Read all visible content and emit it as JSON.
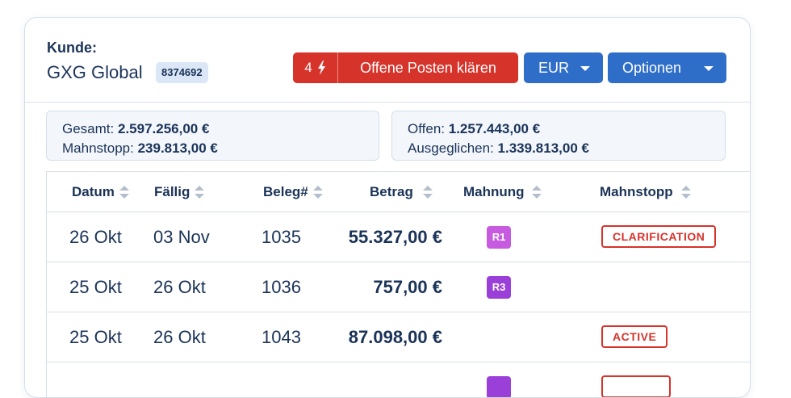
{
  "customer": {
    "label": "Kunde:",
    "name": "GXG Global",
    "id": "8374692"
  },
  "actions": {
    "open_count": "4",
    "open_label": "Offene Posten klären",
    "currency": "EUR",
    "options": "Optionen"
  },
  "summary": {
    "gesamt_label": "Gesamt:",
    "gesamt_value": "2.597.256,00 €",
    "mahnstopp_label": "Mahnstopp:",
    "mahnstopp_value": "239.813,00 €",
    "offen_label": "Offen:",
    "offen_value": "1.257.443,00 €",
    "ausgeglichen_label": "Ausgeglichen:",
    "ausgeglichen_value": "1.339.813,00 €"
  },
  "table": {
    "columns": [
      "Datum",
      "Fällig",
      "Beleg#",
      "Betrag",
      "Mahnung",
      "Mahnstopp"
    ],
    "rows": [
      {
        "datum": "26 Okt",
        "faellig": "03 Nov",
        "beleg": "1035",
        "betrag": "55.327,00 €",
        "mahnung": "R1",
        "mahnung_color": "#c65be0",
        "mahnstopp": "CLARIFICATION"
      },
      {
        "datum": "25 Okt",
        "faellig": "26 Okt",
        "beleg": "1036",
        "betrag": "757,00 €",
        "mahnung": "R3",
        "mahnung_color": "#9b3fd9",
        "mahnstopp": ""
      },
      {
        "datum": "25 Okt",
        "faellig": "26 Okt",
        "beleg": "1043",
        "betrag": "87.098,00 €",
        "mahnung": "",
        "mahnung_color": "",
        "mahnstopp": "ACTIVE"
      }
    ]
  },
  "colors": {
    "primary": "#2f6ec8",
    "danger": "#d6332b",
    "text": "#1b3358",
    "badge_bg": "#dbe7f6"
  }
}
